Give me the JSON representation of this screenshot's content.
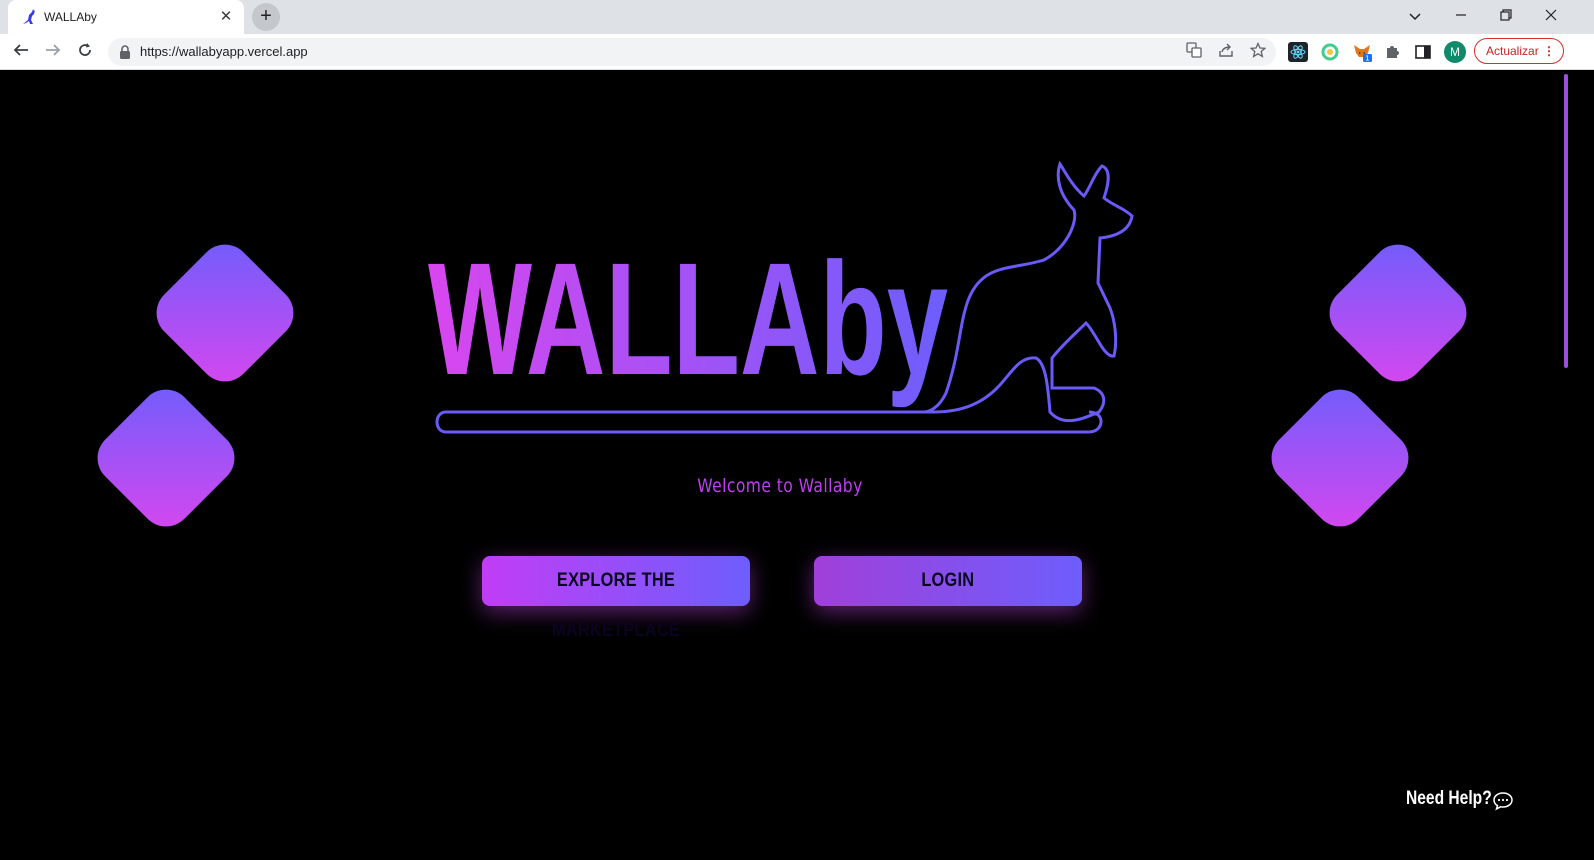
{
  "browser": {
    "tab_title": "WALLAby",
    "new_tab_symbol": "+",
    "close_symbol": "✕",
    "url": "https://wallabyapp.vercel.app",
    "profile_initial": "M",
    "update_label": "Actualizar",
    "update_dots": "⋮",
    "extension_badge": "1"
  },
  "hero": {
    "logo_text": "WALLAby",
    "welcome": "Welcome to Wallaby"
  },
  "actions": {
    "explore_label": "EXPLORE THE MARKETPLACE",
    "login_label": "LOGIN"
  },
  "footer": {
    "help_label": "Need Help?"
  },
  "colors": {
    "gradient_start": "#d946ef",
    "gradient_end": "#6d5efc",
    "welcome_text": "#c13df5",
    "background": "#000000"
  }
}
